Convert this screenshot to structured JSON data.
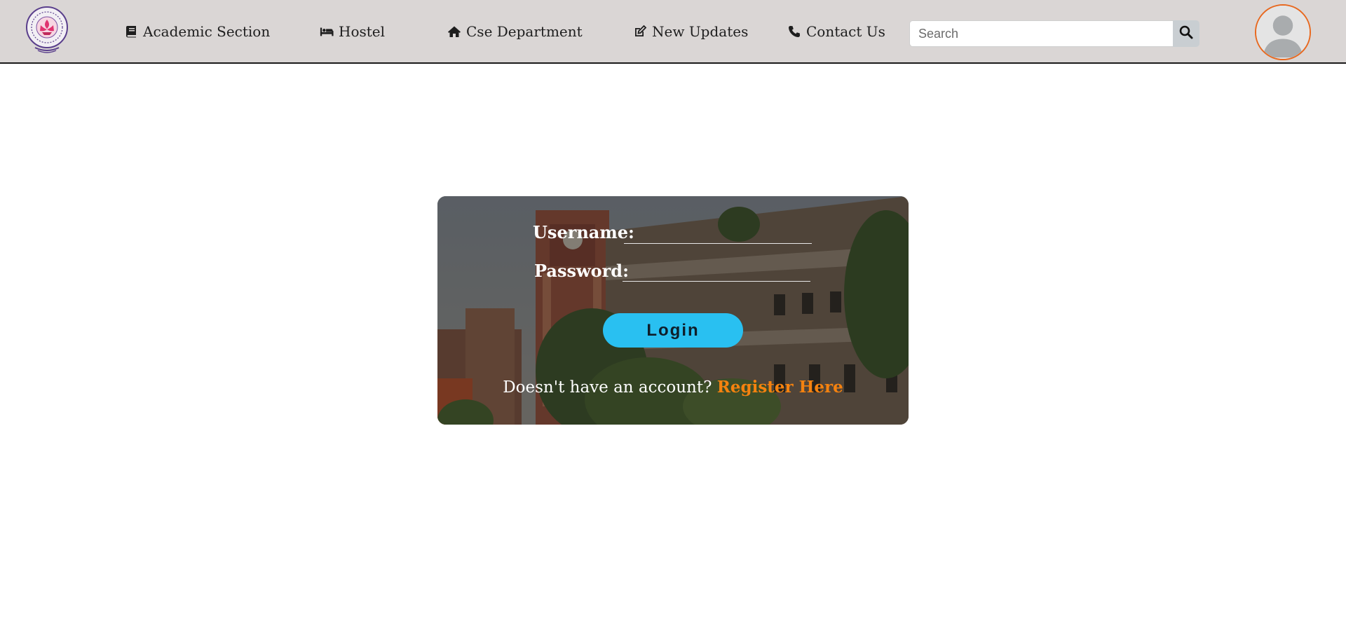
{
  "navbar": {
    "logo_icon": "university-emblem-icon",
    "items": [
      {
        "label": "Academic Section",
        "icon": "book-icon"
      },
      {
        "label": "Hostel",
        "icon": "bed-icon"
      },
      {
        "label": "Cse Department",
        "icon": "home-icon"
      },
      {
        "label": "New Updates",
        "icon": "edit-icon"
      },
      {
        "label": "Contact Us",
        "icon": "phone-icon"
      }
    ],
    "search": {
      "placeholder": "Search",
      "value": "",
      "button_icon": "search-icon"
    },
    "avatar_icon": "user-avatar-icon"
  },
  "login": {
    "username_label": "Username:",
    "username_value": "",
    "password_label": "Password:",
    "password_value": "",
    "button_label": "Login",
    "register_prompt": "Doesn't have an account?",
    "register_link": "Register Here"
  },
  "colors": {
    "navbar_bg": "#dad6d5",
    "login_button": "#29c0f1",
    "register_link": "#f5820f",
    "avatar_border": "#e8681e"
  }
}
